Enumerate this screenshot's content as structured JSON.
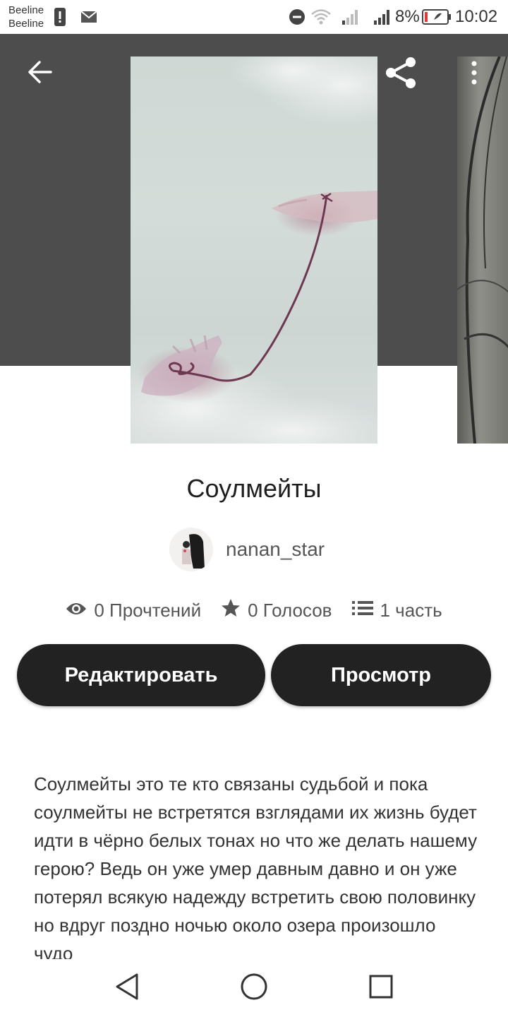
{
  "status_bar": {
    "carrier_1": "Beeline",
    "carrier_2": "Beeline",
    "battery_percent": "8%",
    "time": "10:02"
  },
  "toolbar": {
    "back_icon": "arrow-left-icon",
    "share_icon": "share-icon",
    "more_icon": "more-vertical-icon"
  },
  "story": {
    "title": "Соулмейты",
    "author": "nanan_star",
    "stats": {
      "reads": "0 Прочтений",
      "votes": "0 Голосов",
      "parts": "1 часть"
    },
    "edit_label": "Редактировать",
    "preview_label": "Просмотр",
    "description": "Соулмейты это те кто связаны судьбой и пока соулмейты не встретятся взглядами их жизнь будет идти в чёрно белых тонах но что же делать нашему герою? Ведь он уже умер давным давно и он уже потерял всякую надежду встретить свою половинку но вдруг поздно ночью около озера произошло чудо"
  },
  "nav_bar": {
    "back_icon": "triangle-back-icon",
    "home_icon": "circle-home-icon",
    "recents_icon": "square-recents-icon"
  },
  "colors": {
    "hero_background": "#4d4d4d",
    "button_background": "#222222",
    "button_text": "#ffffff"
  }
}
